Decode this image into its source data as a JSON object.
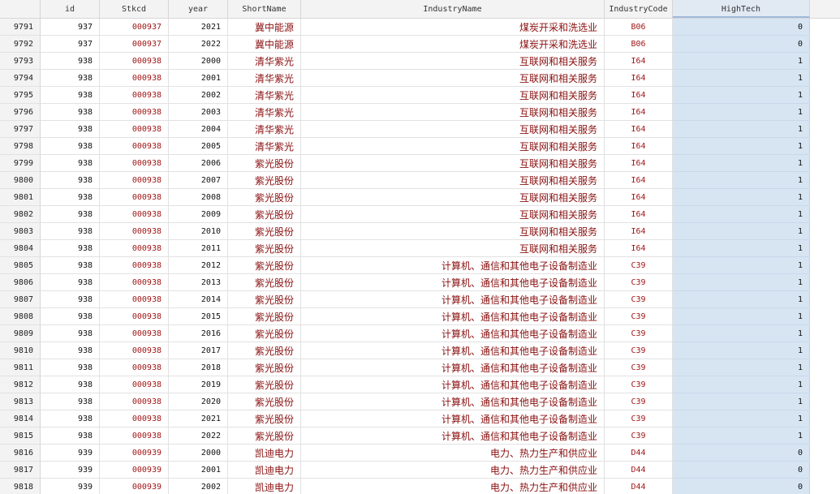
{
  "columns": [
    {
      "key": "rownum",
      "label": ""
    },
    {
      "key": "id",
      "label": "id"
    },
    {
      "key": "stkcd",
      "label": "Stkcd"
    },
    {
      "key": "year",
      "label": "year"
    },
    {
      "key": "shortname",
      "label": "ShortName"
    },
    {
      "key": "industryname",
      "label": "IndustryName"
    },
    {
      "key": "industrycode",
      "label": "IndustryCode"
    },
    {
      "key": "hightech",
      "label": "HighTech"
    }
  ],
  "rows": [
    {
      "rownum": "9791",
      "id": "937",
      "stkcd": "000937",
      "year": "2021",
      "shortname": "冀中能源",
      "industryname": "煤炭开采和洗选业",
      "industrycode": "B06",
      "hightech": "0"
    },
    {
      "rownum": "9792",
      "id": "937",
      "stkcd": "000937",
      "year": "2022",
      "shortname": "冀中能源",
      "industryname": "煤炭开采和洗选业",
      "industrycode": "B06",
      "hightech": "0"
    },
    {
      "rownum": "9793",
      "id": "938",
      "stkcd": "000938",
      "year": "2000",
      "shortname": "清华紫光",
      "industryname": "互联网和相关服务",
      "industrycode": "I64",
      "hightech": "1"
    },
    {
      "rownum": "9794",
      "id": "938",
      "stkcd": "000938",
      "year": "2001",
      "shortname": "清华紫光",
      "industryname": "互联网和相关服务",
      "industrycode": "I64",
      "hightech": "1"
    },
    {
      "rownum": "9795",
      "id": "938",
      "stkcd": "000938",
      "year": "2002",
      "shortname": "清华紫光",
      "industryname": "互联网和相关服务",
      "industrycode": "I64",
      "hightech": "1"
    },
    {
      "rownum": "9796",
      "id": "938",
      "stkcd": "000938",
      "year": "2003",
      "shortname": "清华紫光",
      "industryname": "互联网和相关服务",
      "industrycode": "I64",
      "hightech": "1"
    },
    {
      "rownum": "9797",
      "id": "938",
      "stkcd": "000938",
      "year": "2004",
      "shortname": "清华紫光",
      "industryname": "互联网和相关服务",
      "industrycode": "I64",
      "hightech": "1"
    },
    {
      "rownum": "9798",
      "id": "938",
      "stkcd": "000938",
      "year": "2005",
      "shortname": "清华紫光",
      "industryname": "互联网和相关服务",
      "industrycode": "I64",
      "hightech": "1"
    },
    {
      "rownum": "9799",
      "id": "938",
      "stkcd": "000938",
      "year": "2006",
      "shortname": "紫光股份",
      "industryname": "互联网和相关服务",
      "industrycode": "I64",
      "hightech": "1"
    },
    {
      "rownum": "9800",
      "id": "938",
      "stkcd": "000938",
      "year": "2007",
      "shortname": "紫光股份",
      "industryname": "互联网和相关服务",
      "industrycode": "I64",
      "hightech": "1"
    },
    {
      "rownum": "9801",
      "id": "938",
      "stkcd": "000938",
      "year": "2008",
      "shortname": "紫光股份",
      "industryname": "互联网和相关服务",
      "industrycode": "I64",
      "hightech": "1"
    },
    {
      "rownum": "9802",
      "id": "938",
      "stkcd": "000938",
      "year": "2009",
      "shortname": "紫光股份",
      "industryname": "互联网和相关服务",
      "industrycode": "I64",
      "hightech": "1"
    },
    {
      "rownum": "9803",
      "id": "938",
      "stkcd": "000938",
      "year": "2010",
      "shortname": "紫光股份",
      "industryname": "互联网和相关服务",
      "industrycode": "I64",
      "hightech": "1"
    },
    {
      "rownum": "9804",
      "id": "938",
      "stkcd": "000938",
      "year": "2011",
      "shortname": "紫光股份",
      "industryname": "互联网和相关服务",
      "industrycode": "I64",
      "hightech": "1"
    },
    {
      "rownum": "9805",
      "id": "938",
      "stkcd": "000938",
      "year": "2012",
      "shortname": "紫光股份",
      "industryname": "计算机、通信和其他电子设备制造业",
      "industrycode": "C39",
      "hightech": "1"
    },
    {
      "rownum": "9806",
      "id": "938",
      "stkcd": "000938",
      "year": "2013",
      "shortname": "紫光股份",
      "industryname": "计算机、通信和其他电子设备制造业",
      "industrycode": "C39",
      "hightech": "1"
    },
    {
      "rownum": "9807",
      "id": "938",
      "stkcd": "000938",
      "year": "2014",
      "shortname": "紫光股份",
      "industryname": "计算机、通信和其他电子设备制造业",
      "industrycode": "C39",
      "hightech": "1"
    },
    {
      "rownum": "9808",
      "id": "938",
      "stkcd": "000938",
      "year": "2015",
      "shortname": "紫光股份",
      "industryname": "计算机、通信和其他电子设备制造业",
      "industrycode": "C39",
      "hightech": "1"
    },
    {
      "rownum": "9809",
      "id": "938",
      "stkcd": "000938",
      "year": "2016",
      "shortname": "紫光股份",
      "industryname": "计算机、通信和其他电子设备制造业",
      "industrycode": "C39",
      "hightech": "1"
    },
    {
      "rownum": "9810",
      "id": "938",
      "stkcd": "000938",
      "year": "2017",
      "shortname": "紫光股份",
      "industryname": "计算机、通信和其他电子设备制造业",
      "industrycode": "C39",
      "hightech": "1"
    },
    {
      "rownum": "9811",
      "id": "938",
      "stkcd": "000938",
      "year": "2018",
      "shortname": "紫光股份",
      "industryname": "计算机、通信和其他电子设备制造业",
      "industrycode": "C39",
      "hightech": "1"
    },
    {
      "rownum": "9812",
      "id": "938",
      "stkcd": "000938",
      "year": "2019",
      "shortname": "紫光股份",
      "industryname": "计算机、通信和其他电子设备制造业",
      "industrycode": "C39",
      "hightech": "1"
    },
    {
      "rownum": "9813",
      "id": "938",
      "stkcd": "000938",
      "year": "2020",
      "shortname": "紫光股份",
      "industryname": "计算机、通信和其他电子设备制造业",
      "industrycode": "C39",
      "hightech": "1"
    },
    {
      "rownum": "9814",
      "id": "938",
      "stkcd": "000938",
      "year": "2021",
      "shortname": "紫光股份",
      "industryname": "计算机、通信和其他电子设备制造业",
      "industrycode": "C39",
      "hightech": "1"
    },
    {
      "rownum": "9815",
      "id": "938",
      "stkcd": "000938",
      "year": "2022",
      "shortname": "紫光股份",
      "industryname": "计算机、通信和其他电子设备制造业",
      "industrycode": "C39",
      "hightech": "1"
    },
    {
      "rownum": "9816",
      "id": "939",
      "stkcd": "000939",
      "year": "2000",
      "shortname": "凯迪电力",
      "industryname": "电力、热力生产和供应业",
      "industrycode": "D44",
      "hightech": "0"
    },
    {
      "rownum": "9817",
      "id": "939",
      "stkcd": "000939",
      "year": "2001",
      "shortname": "凯迪电力",
      "industryname": "电力、热力生产和供应业",
      "industrycode": "D44",
      "hightech": "0"
    },
    {
      "rownum": "9818",
      "id": "939",
      "stkcd": "000939",
      "year": "2002",
      "shortname": "凯迪电力",
      "industryname": "电力、热力生产和供应业",
      "industrycode": "D44",
      "hightech": "0"
    }
  ],
  "colors": {
    "header_bg": "#f3f3f3",
    "string_red": "#a11818",
    "cjk_text": "#8a1010",
    "selected_column": "#d7e5f3"
  }
}
